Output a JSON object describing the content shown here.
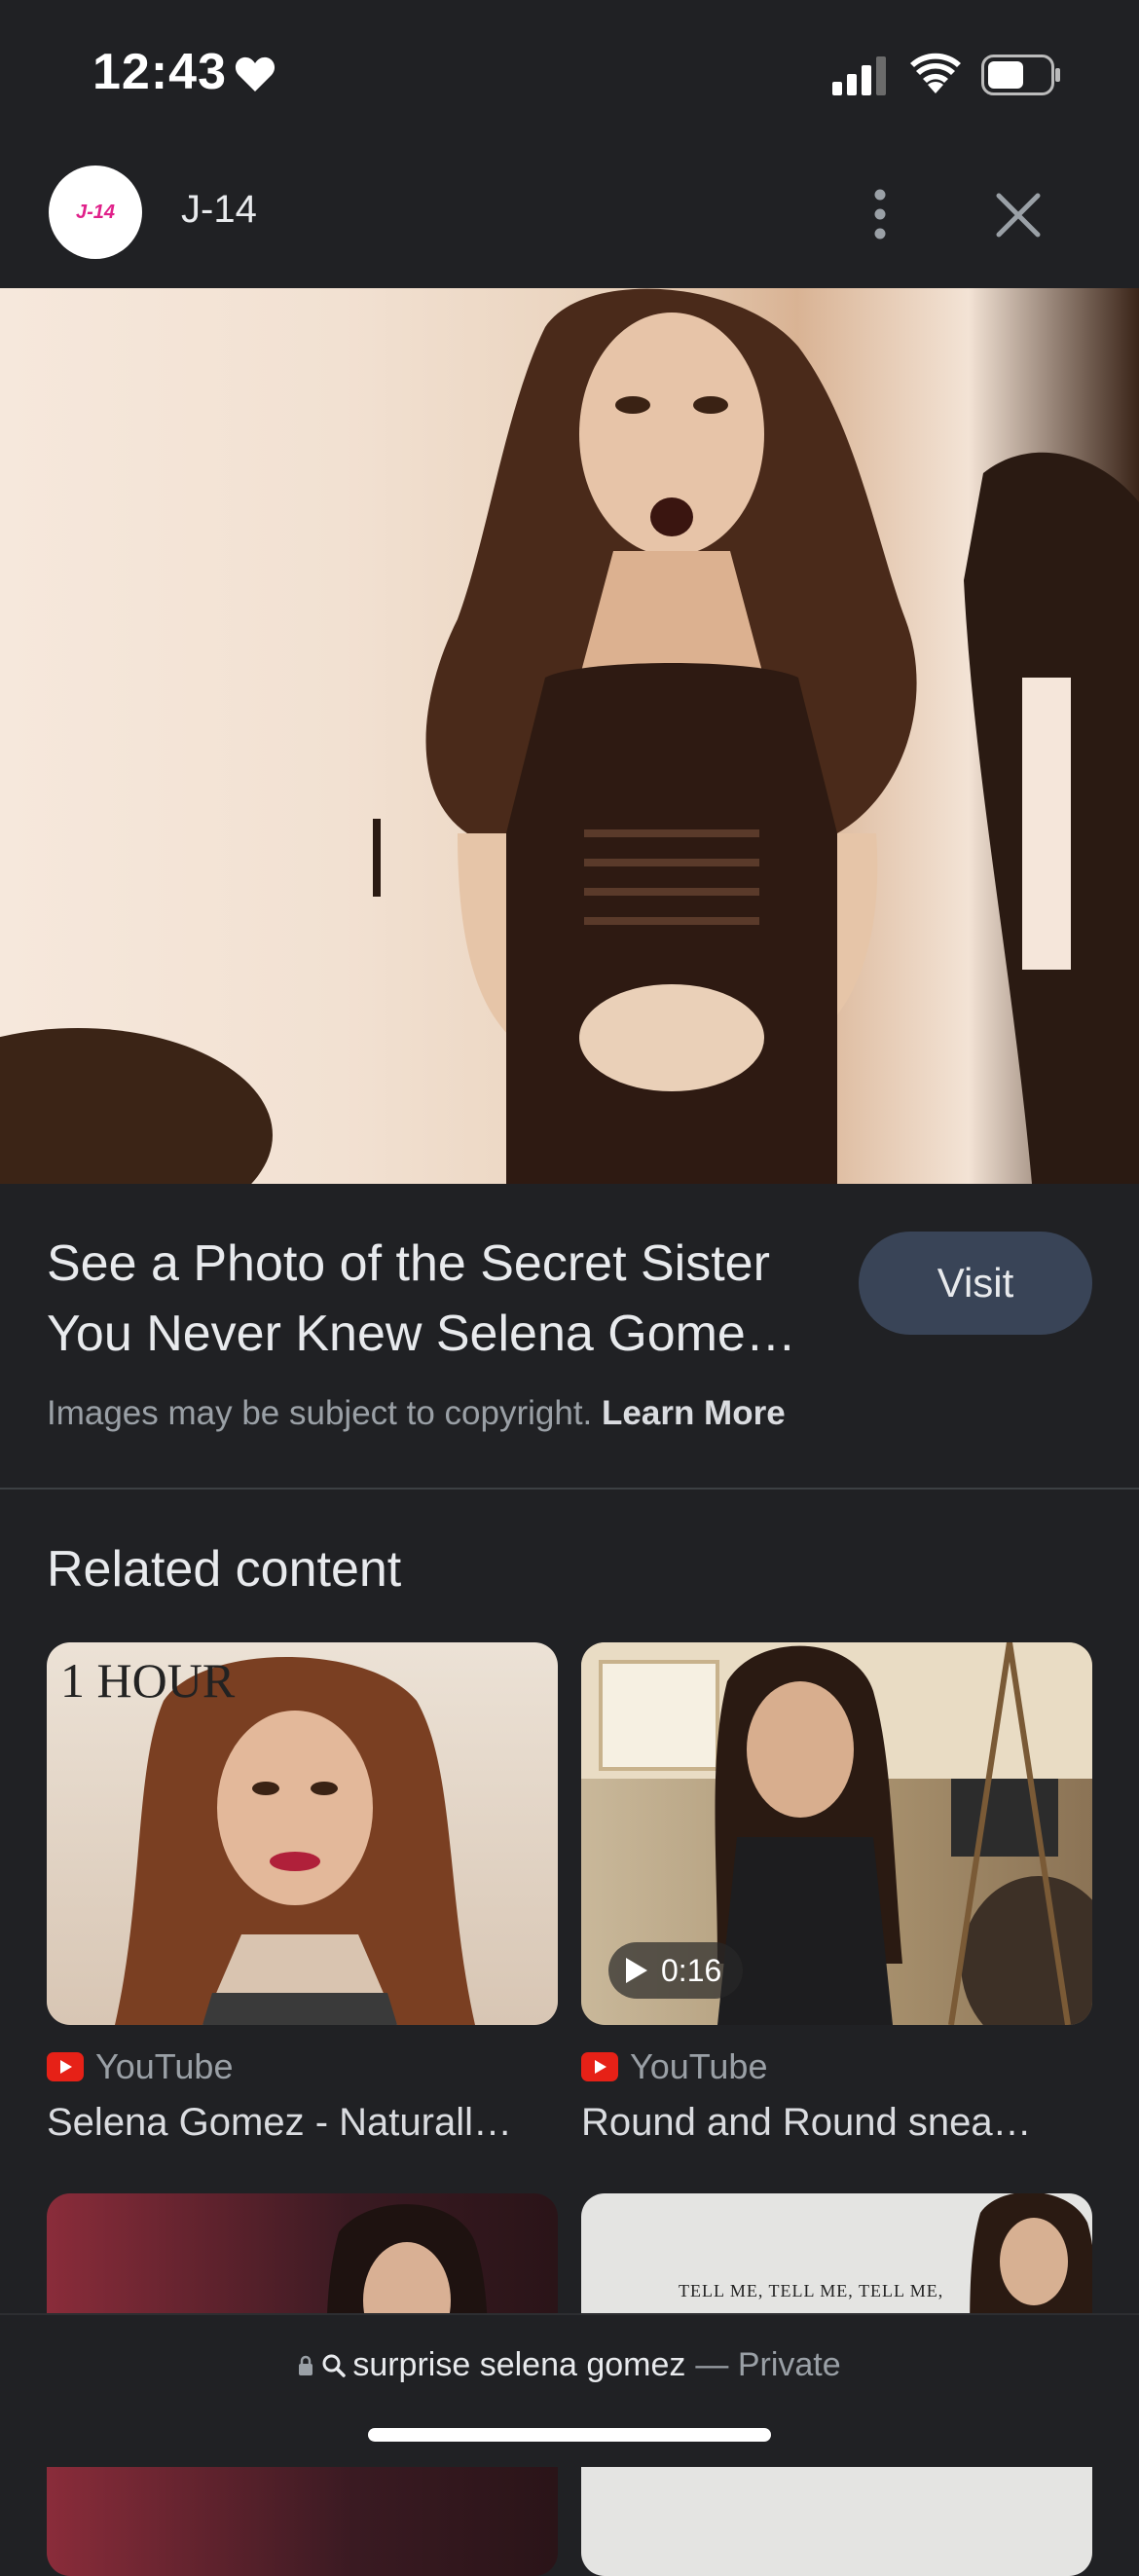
{
  "status_bar": {
    "time": "12:43"
  },
  "header": {
    "logo_text": "J-14",
    "site_name": "J-14"
  },
  "result": {
    "title_line1": "See a Photo of the Secret Sister",
    "title_line2": "You Never Knew Selena Gome…",
    "visit_label": "Visit",
    "copyright_text": "Images may be subject to copyright.",
    "learn_more": "Learn More"
  },
  "related": {
    "heading": "Related content",
    "cards": [
      {
        "source": "YouTube",
        "title": "Selena Gomez - Naturall…",
        "overlay": "1 HOUR"
      },
      {
        "source": "YouTube",
        "title": "Round and Round snea…",
        "duration": "0:16"
      },
      {
        "source": "",
        "title": ""
      },
      {
        "source": "",
        "title": "",
        "overlay": "TELL ME, TELL ME, TELL ME,"
      }
    ]
  },
  "bottom_bar": {
    "query": "surprise selena gomez",
    "private_label": "— Private"
  }
}
